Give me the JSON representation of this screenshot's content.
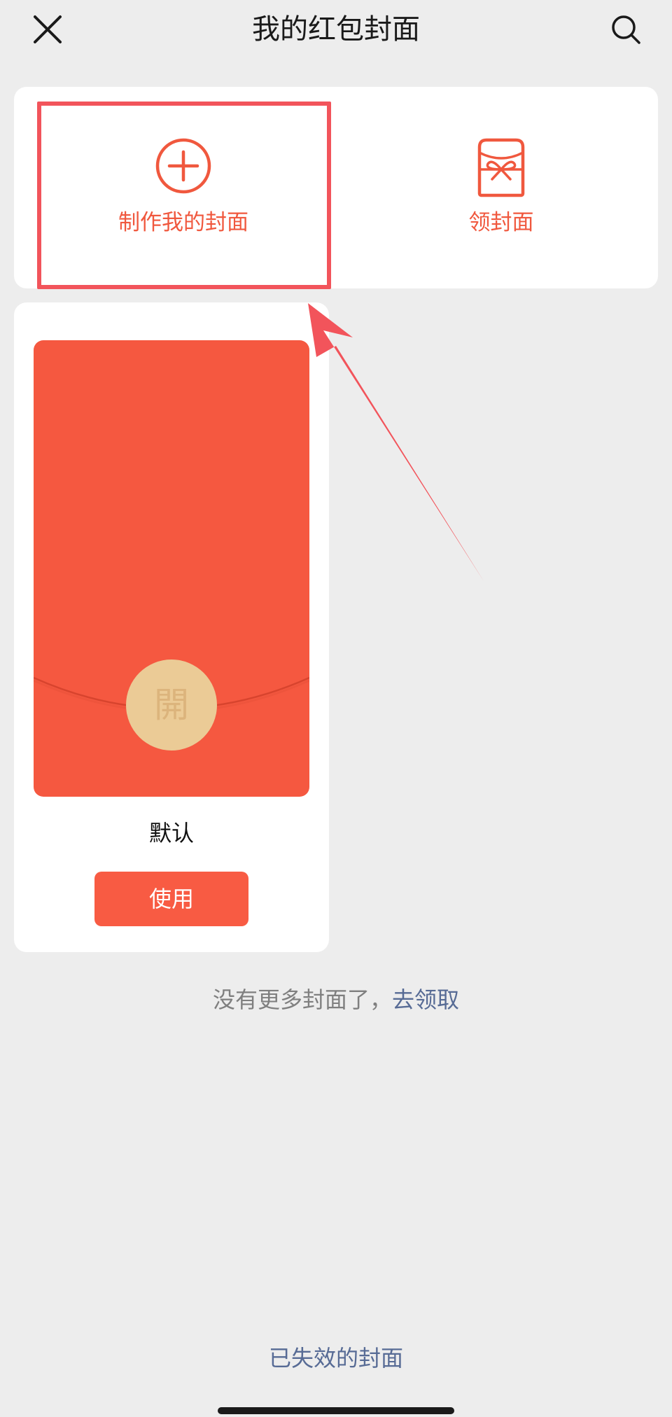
{
  "nav": {
    "title": "我的红包封面",
    "close_icon": "close-icon",
    "search_icon": "search-icon"
  },
  "actions": {
    "make_cover": {
      "label": "制作我的封面",
      "icon": "plus-circle-icon"
    },
    "get_cover": {
      "label": "领封面",
      "icon": "gift-envelope-icon"
    }
  },
  "cover": {
    "seal_char": "開",
    "name": "默认",
    "use_label": "使用"
  },
  "footer": {
    "no_more_text": "没有更多封面了，",
    "get_link": "去领取"
  },
  "expired": {
    "label": "已失效的封面"
  },
  "colors": {
    "accent": "#f0583e",
    "envelope_red": "#f55840",
    "seal_gold": "#ebcb96",
    "link_blue": "#576b95",
    "annotation_red": "#f2545b",
    "background": "#ededed"
  }
}
